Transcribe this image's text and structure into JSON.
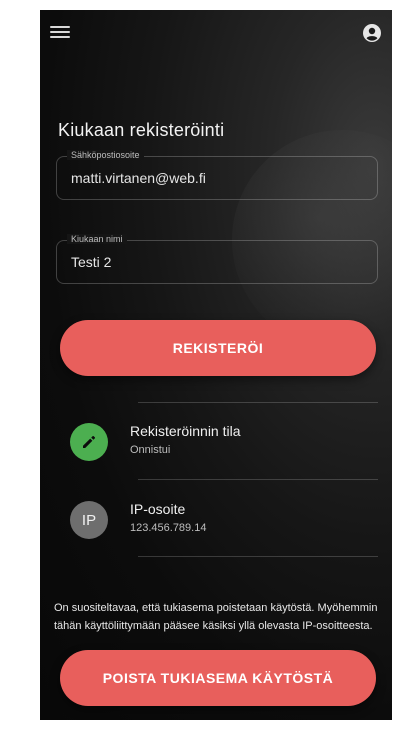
{
  "header": {
    "menu_icon": "menu-icon",
    "account_icon": "account-circle-icon"
  },
  "page_title": "Kiukaan rekisteröinti",
  "form": {
    "email": {
      "label": "Sähköpostiosoite",
      "value": "matti.virtanen@web.fi"
    },
    "name": {
      "label": "Kiukaan nimi",
      "value": "Testi 2"
    }
  },
  "register_button": "REKISTERÖI",
  "status_items": [
    {
      "icon": "pencil-icon",
      "title": "Rekisteröinnin tila",
      "subtitle": "Onnistui",
      "color": "#4caf50"
    },
    {
      "avatar_text": "IP",
      "title": "IP-osoite",
      "subtitle": "123.456.789.14"
    }
  ],
  "note": "On suositeltavaa, että tukiasema poistetaan käytöstä. Myöhemmin tähän käyttöliittymään pääsee käsiksi yllä olevasta IP-osoitteesta.",
  "disable_button": "POISTA TUKIASEMA KÄYTÖSTÄ",
  "colors": {
    "accent": "#e85f5c",
    "success": "#4caf50",
    "background": "#0c0c0c"
  }
}
